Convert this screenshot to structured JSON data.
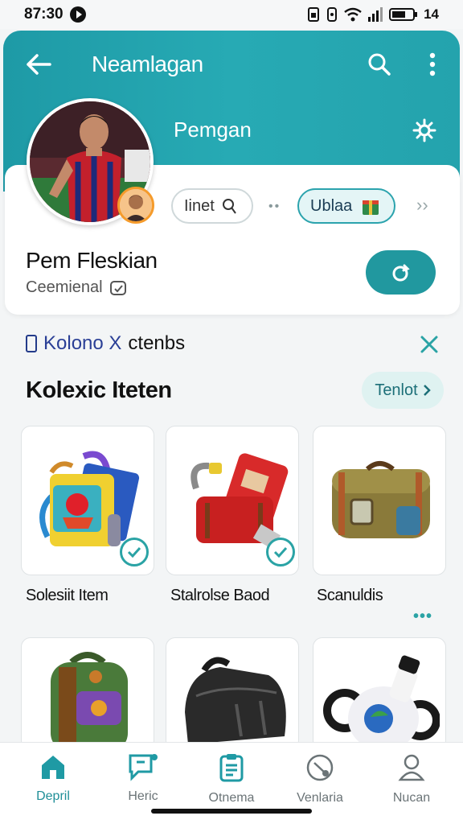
{
  "status_bar": {
    "time": "87:30",
    "battery": "14"
  },
  "header": {
    "title": "Neamlagan",
    "subtitle": "Pemgan"
  },
  "profile": {
    "chips": [
      {
        "label": "Iinet"
      },
      {
        "label": "Ublaa"
      }
    ],
    "name": "Pem Fleskian",
    "subtitle": "Ceemienal"
  },
  "collection": {
    "tag_prefix": "Kolono X",
    "tag_suffix": "ctenbs",
    "title": "Kolexic Iteten",
    "action_label": "Tenlot"
  },
  "items": [
    {
      "label": "Solesiit Item",
      "checked": true,
      "icon": "toy-bag-icon"
    },
    {
      "label": "Stalrolse Baod",
      "checked": true,
      "icon": "red-case-icon"
    },
    {
      "label": "Scanuldis",
      "checked": false,
      "icon": "trunk-icon"
    },
    {
      "label": "",
      "checked": false,
      "icon": "backpack-icon"
    },
    {
      "label": "",
      "checked": false,
      "icon": "leather-bag-icon"
    },
    {
      "label": "",
      "checked": false,
      "icon": "robot-toy-icon"
    }
  ],
  "nav": [
    {
      "label": "Depril",
      "icon": "home-icon",
      "active": true
    },
    {
      "label": "Heric",
      "icon": "chat-icon",
      "active": false
    },
    {
      "label": "Otnema",
      "icon": "clipboard-icon",
      "active": false
    },
    {
      "label": "Venlaria",
      "icon": "compass-icon",
      "active": false
    },
    {
      "label": "Nucan",
      "icon": "profile-icon",
      "active": false
    }
  ],
  "colors": {
    "accent": "#21989f",
    "header": "#27aab4"
  }
}
